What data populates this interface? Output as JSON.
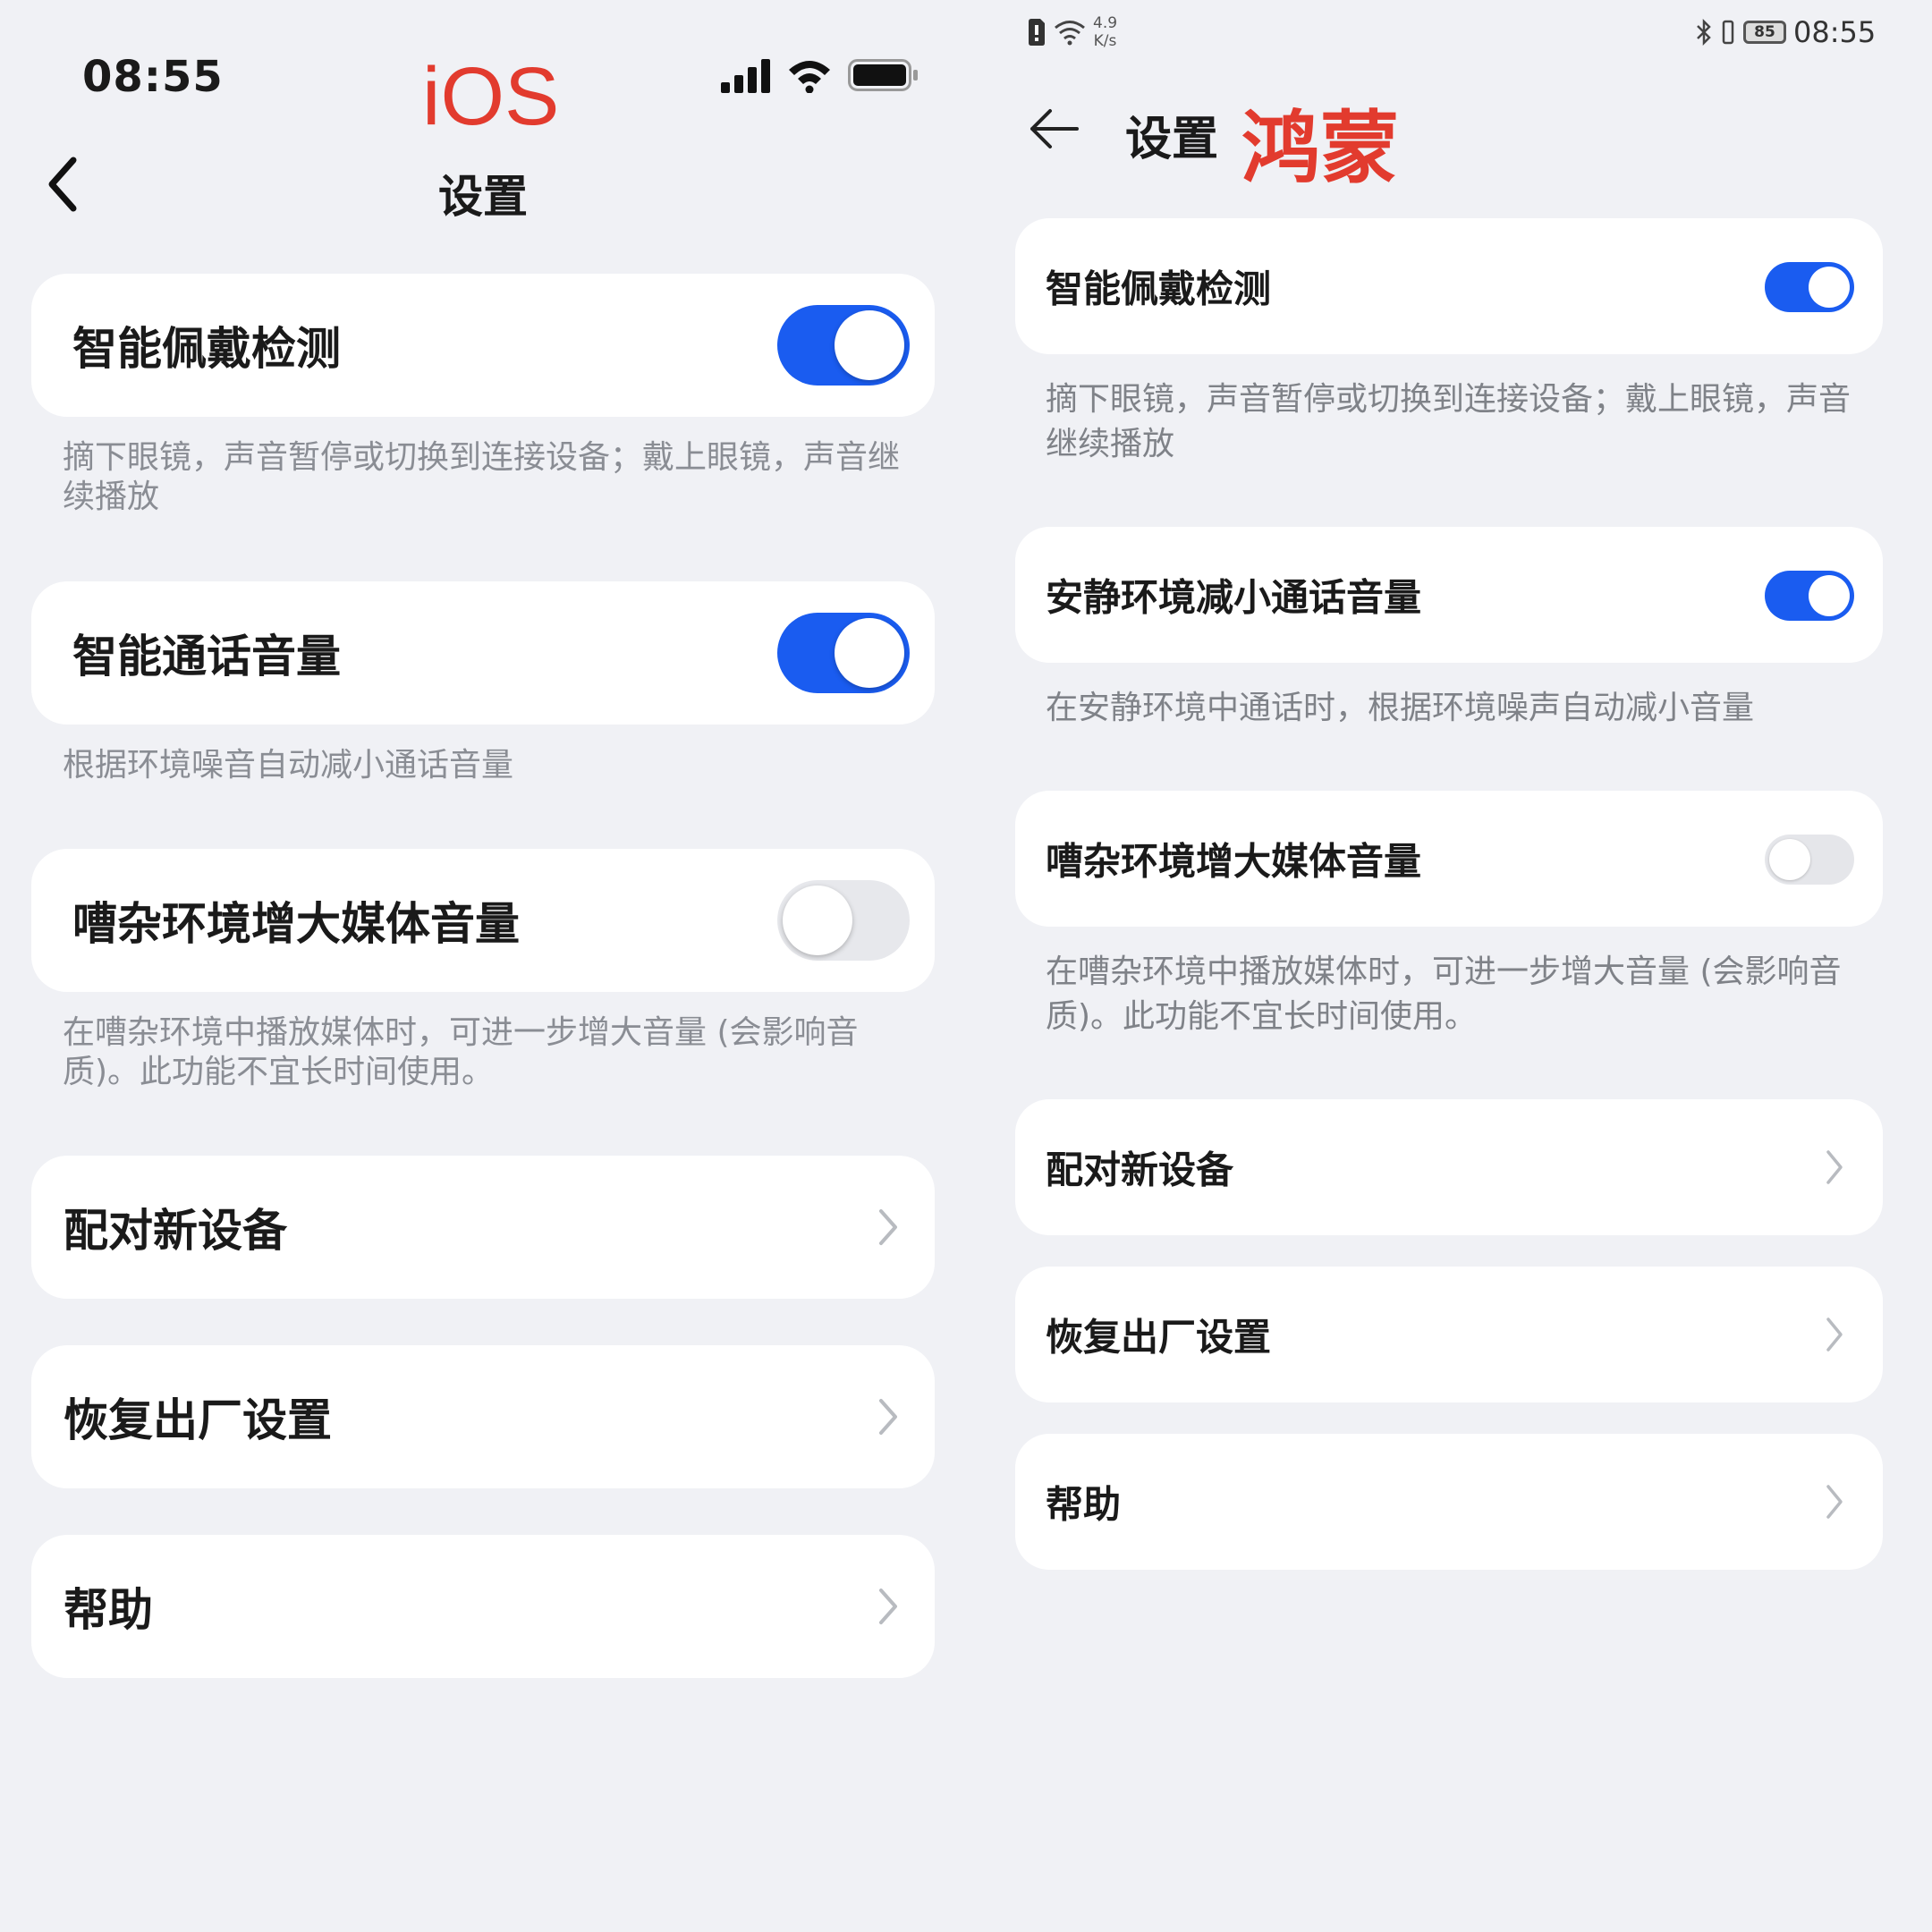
{
  "ios": {
    "tag": "iOS",
    "status_time": "08:55",
    "title": "设置",
    "items": [
      {
        "label": "智能佩戴检测",
        "toggle": true,
        "desc": "摘下眼镜，声音暂停或切换到连接设备；戴上眼镜，声音继续播放"
      },
      {
        "label": "智能通话音量",
        "toggle": true,
        "desc": "根据环境噪音自动减小通话音量"
      },
      {
        "label": "嘈杂环境增大媒体音量",
        "toggle": false,
        "desc": "在嘈杂环境中播放媒体时，可进一步增大音量 (会影响音质)。此功能不宜长时间使用。"
      }
    ],
    "nav_items": [
      "配对新设备",
      "恢复出厂设置",
      "帮助"
    ]
  },
  "harmony": {
    "tag": "鸿蒙",
    "status_time": "08:55",
    "net_speed_value": "4.9",
    "net_speed_unit": "K/s",
    "battery": "85",
    "title": "设置",
    "items": [
      {
        "label": "智能佩戴检测",
        "toggle": true,
        "desc": "摘下眼镜，声音暂停或切换到连接设备；戴上眼镜，声音继续播放"
      },
      {
        "label": "安静环境减小通话音量",
        "toggle": true,
        "desc": "在安静环境中通话时，根据环境噪声自动减小音量"
      },
      {
        "label": "嘈杂环境增大媒体音量",
        "toggle": false,
        "desc": "在嘈杂环境中播放媒体时，可进一步增大音量 (会影响音质)。此功能不宜长时间使用。"
      }
    ],
    "nav_items": [
      "配对新设备",
      "恢复出厂设置",
      "帮助"
    ]
  },
  "colors": {
    "accent": "#1a5cf0",
    "tag_red": "#e23b2e",
    "background": "#f0f1f5",
    "desc_text": "#8a8d94"
  },
  "icons": [
    "signal-icon",
    "wifi-icon",
    "battery-icon",
    "back-chevron-icon",
    "back-arrow-icon",
    "chevron-right-icon",
    "bluetooth-icon",
    "vibrate-icon",
    "sim-icon"
  ]
}
